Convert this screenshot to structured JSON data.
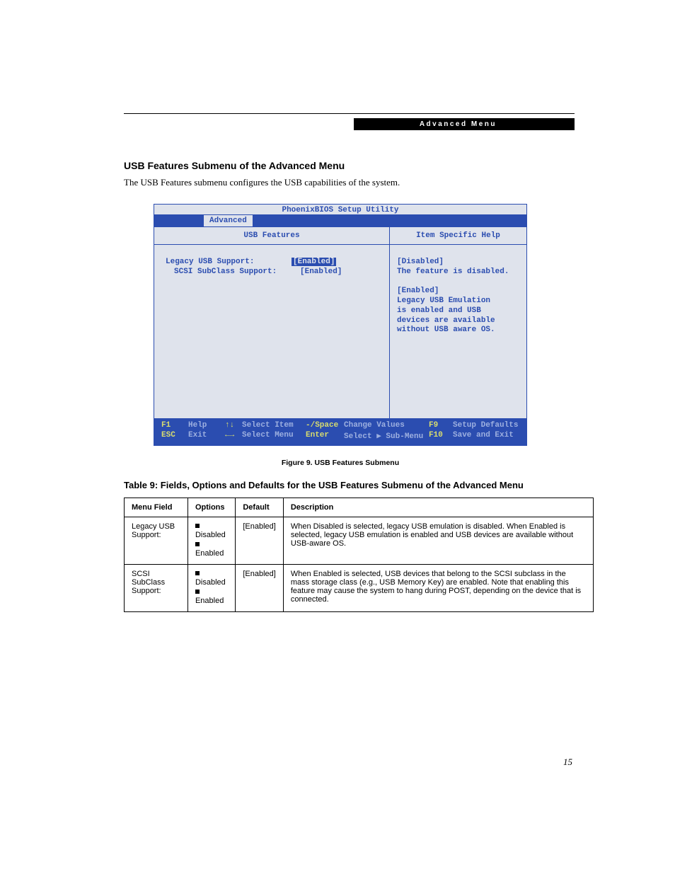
{
  "banner": "Advanced Menu",
  "heading": "USB Features Submenu of the Advanced Menu",
  "intro": "The USB Features submenu configures the USB capabilities of the system.",
  "bios": {
    "title": "PhoenixBIOS Setup Utility",
    "menubar_active": "Advanced",
    "left_header": "USB Features",
    "right_header": "Item Specific Help",
    "options": [
      {
        "label": "Legacy USB Support:",
        "value": "[Enabled]",
        "selected": true,
        "indent": false
      },
      {
        "label": "SCSI SubClass Support:",
        "value": "[Enabled]",
        "selected": false,
        "indent": true
      }
    ],
    "help_text": "[Disabled]\nThe feature is disabled.\n\n[Enabled]\nLegacy USB Emulation\nis enabled and USB\ndevices are available\nwithout USB aware OS.",
    "footer": {
      "r1": {
        "k1": "F1",
        "v1": "Help",
        "sym1": "↑↓",
        "t1": "Select Item",
        "k2": "-/Space",
        "v2": "Change Values",
        "k3": "F9",
        "v3": "Setup Defaults"
      },
      "r2": {
        "k1": "ESC",
        "v1": "Exit",
        "sym1": "←→",
        "t1": "Select Menu",
        "k2": "Enter",
        "v2": "Select ▶ Sub-Menu",
        "k3": "F10",
        "v3": "Save and Exit"
      }
    }
  },
  "figure_caption": "Figure 9.  USB Features Submenu",
  "table_title": "Table 9: Fields, Options and Defaults for the USB Features Submenu of the Advanced Menu",
  "table": {
    "headers": [
      "Menu Field",
      "Options",
      "Default",
      "Description"
    ],
    "rows": [
      {
        "field": "Legacy USB Support:",
        "options": [
          "Disabled",
          "Enabled"
        ],
        "default": "[Enabled]",
        "description": "When Disabled is selected, legacy USB emulation is disabled. When Enabled is selected, legacy USB emulation is enabled and USB devices are available without USB-aware OS."
      },
      {
        "field": "SCSI SubClass Support:",
        "options": [
          "Disabled",
          "Enabled"
        ],
        "default": "[Enabled]",
        "description": "When Enabled is selected, USB devices that belong to the SCSI subclass in the mass storage class (e.g., USB Memory Key) are enabled. Note that enabling this feature may cause the system to hang during POST, depending on the device that is connected."
      }
    ]
  },
  "page_number": "15"
}
